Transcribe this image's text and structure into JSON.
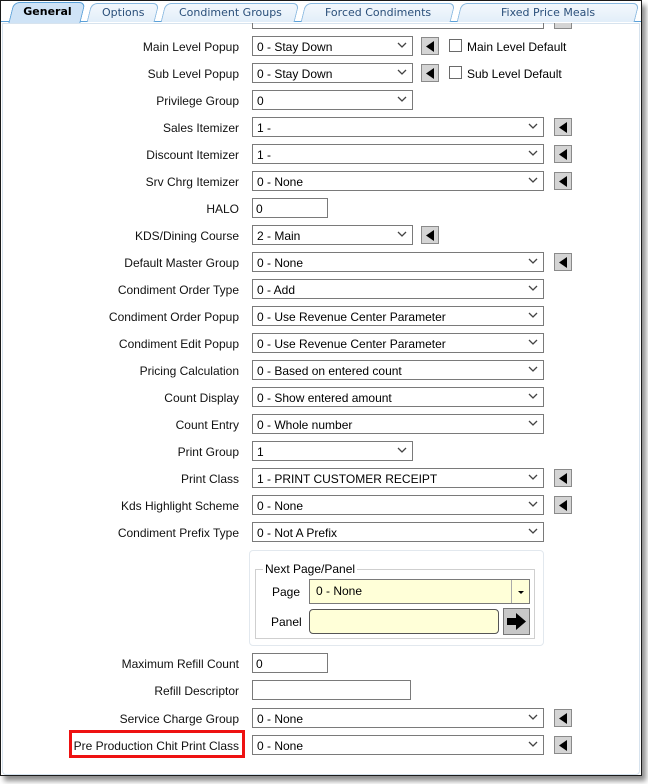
{
  "tabs": [
    {
      "label": "General",
      "active": true
    },
    {
      "label": "Options",
      "active": false
    },
    {
      "label": "Condiment Groups",
      "active": false
    },
    {
      "label": "Forced Condiments",
      "active": false
    },
    {
      "label": "Fixed Price Meals",
      "active": false
    }
  ],
  "fields": {
    "main_level_popup": {
      "label": "Main Level Popup",
      "value": "0 - Stay Down",
      "checkbox_label": "Main Level Default",
      "checked": false
    },
    "sub_level_popup": {
      "label": "Sub Level Popup",
      "value": "0 - Stay Down",
      "checkbox_label": "Sub Level Default",
      "checked": false
    },
    "privilege_group": {
      "label": "Privilege Group",
      "value": "0"
    },
    "sales_itemizer": {
      "label": "Sales Itemizer",
      "value": "1 -"
    },
    "discount_itemizer": {
      "label": "Discount Itemizer",
      "value": "1 -"
    },
    "srv_chrg_itemizer": {
      "label": "Srv Chrg Itemizer",
      "value": "0 - None"
    },
    "halo": {
      "label": "HALO",
      "value": "0"
    },
    "kds_dining_course": {
      "label": "KDS/Dining Course",
      "value": "2 - Main"
    },
    "default_master_group": {
      "label": "Default Master Group",
      "value": "0 - None"
    },
    "condiment_order_type": {
      "label": "Condiment Order Type",
      "value": "0 - Add"
    },
    "condiment_order_popup": {
      "label": "Condiment Order Popup",
      "value": "0 - Use Revenue Center Parameter"
    },
    "condiment_edit_popup": {
      "label": "Condiment Edit Popup",
      "value": "0 - Use Revenue Center Parameter"
    },
    "pricing_calculation": {
      "label": "Pricing Calculation",
      "value": "0 - Based on entered count"
    },
    "count_display": {
      "label": "Count Display",
      "value": "0 - Show entered amount"
    },
    "count_entry": {
      "label": "Count Entry",
      "value": "0 - Whole number"
    },
    "print_group": {
      "label": "Print Group",
      "value": "1"
    },
    "print_class": {
      "label": "Print Class",
      "value": "1 - PRINT CUSTOMER RECEIPT"
    },
    "kds_highlight_scheme": {
      "label": "Kds Highlight Scheme",
      "value": "0 - None"
    },
    "condiment_prefix_type": {
      "label": "Condiment Prefix Type",
      "value": "0 - Not A Prefix"
    },
    "maximum_refill_count": {
      "label": "Maximum Refill Count",
      "value": "0"
    },
    "refill_descriptor": {
      "label": "Refill Descriptor",
      "value": ""
    },
    "service_charge_group": {
      "label": "Service Charge Group",
      "value": "0 - None"
    },
    "pre_production_chit_print_class": {
      "label": "Pre Production Chit Print Class",
      "value": "0 - None",
      "highlighted": true
    }
  },
  "next_page_panel": {
    "title": "Next Page/Panel",
    "page_label": "Page",
    "page_value": "0 - None",
    "panel_label": "Panel",
    "panel_value": ""
  },
  "colors": {
    "highlight": "#ee1111",
    "tab_border": "#5aa0d8",
    "yellow_field": "#ffffd8"
  }
}
